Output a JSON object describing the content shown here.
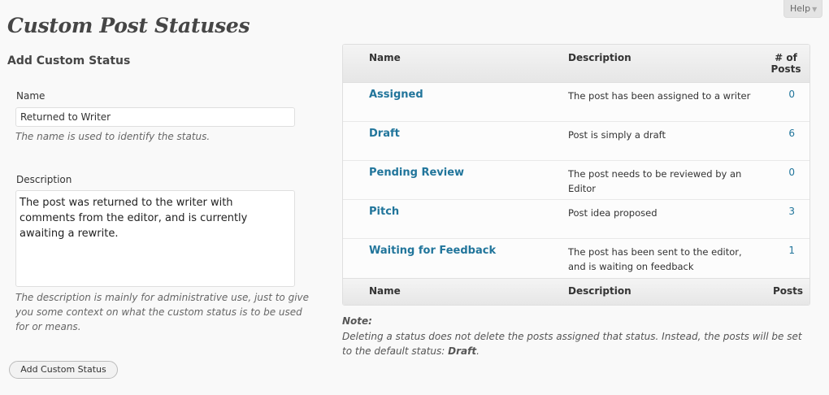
{
  "help": {
    "label": "Help"
  },
  "page": {
    "title": "Custom Post Statuses"
  },
  "form": {
    "heading": "Add Custom Status",
    "name_label": "Name",
    "name_value": "Returned to Writer",
    "name_hint": "The name is used to identify the status.",
    "description_label": "Description",
    "description_value": "The post was returned to the writer with comments from the editor, and is currently awaiting a rewrite.",
    "description_hint": "The description is mainly for administrative use, just to give you some context on what the custom status is to be used for or means.",
    "submit_label": "Add Custom Status"
  },
  "table": {
    "header": {
      "name": "Name",
      "description": "Description",
      "count": "# of Posts"
    },
    "footer": {
      "name": "Name",
      "description": "Description",
      "count": "Posts"
    },
    "rows": [
      {
        "name": "Assigned",
        "description": "The post has been assigned to a writer",
        "count": "0"
      },
      {
        "name": "Draft",
        "description": "Post is simply a draft",
        "count": "6"
      },
      {
        "name": "Pending Review",
        "description": "The post needs to be reviewed by an Editor",
        "count": "0"
      },
      {
        "name": "Pitch",
        "description": "Post idea proposed",
        "count": "3"
      },
      {
        "name": "Waiting for Feedback",
        "description": "The post has been sent to the editor, and is waiting on feedback",
        "count": "1"
      }
    ]
  },
  "note": {
    "title": "Note:",
    "text": "Deleting a status does not delete the posts assigned that status. Instead, the posts will be set to the default status: ",
    "default_status": "Draft",
    "text_end": "."
  }
}
